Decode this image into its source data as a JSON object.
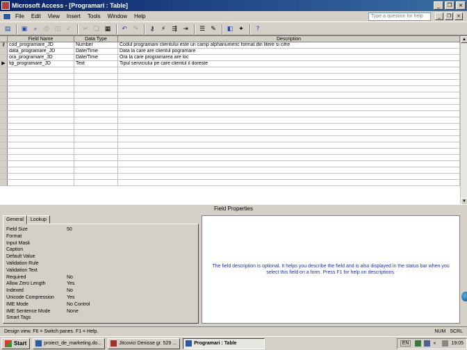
{
  "window": {
    "title": "Microsoft Access - [Programari : Table]"
  },
  "menu": {
    "items": [
      "File",
      "Edit",
      "View",
      "Insert",
      "Tools",
      "Window",
      "Help"
    ],
    "help_placeholder": "Type a question for help"
  },
  "toolbar": {
    "icons": [
      "view-icon",
      "save-icon",
      "search-icon",
      "print-icon",
      "preview-icon",
      "spelling-icon",
      "cut-icon",
      "copy-icon",
      "paste-icon",
      "undo-icon",
      "redo-icon",
      "primary-key-icon",
      "indexes-icon",
      "insert-rows-icon",
      "delete-rows-icon",
      "properties-icon",
      "build-icon",
      "database-window-icon",
      "new-object-icon",
      "help-icon"
    ]
  },
  "table": {
    "headers": {
      "field_name": "Field Name",
      "data_type": "Data Type",
      "description": "Description"
    },
    "rows": [
      {
        "field_name": "cod_programare_JD",
        "data_type": "Number",
        "description": "Codul programarii clientului este un camp alphanumeric format din litere si cifre",
        "primary_key": true
      },
      {
        "field_name": "data_programare_JD",
        "data_type": "Date/Time",
        "description": "Data la care are clientul pogramare"
      },
      {
        "field_name": "ora_programare_JD",
        "data_type": "Date/Time",
        "description": "Ora la care programarea are loc"
      },
      {
        "field_name": "tip_programare_JD",
        "data_type": "Text",
        "description": "Tipul serviciului pe care clientul il doreste",
        "current": true
      }
    ]
  },
  "field_properties": {
    "label": "Field Properties",
    "tabs": [
      "General",
      "Lookup"
    ],
    "properties": [
      {
        "name": "Field Size",
        "value": "50"
      },
      {
        "name": "Format",
        "value": ""
      },
      {
        "name": "Input Mask",
        "value": ""
      },
      {
        "name": "Caption",
        "value": ""
      },
      {
        "name": "Default Value",
        "value": ""
      },
      {
        "name": "Validation Rule",
        "value": ""
      },
      {
        "name": "Validation Text",
        "value": ""
      },
      {
        "name": "Required",
        "value": "No"
      },
      {
        "name": "Allow Zero Length",
        "value": "Yes"
      },
      {
        "name": "Indexed",
        "value": "No"
      },
      {
        "name": "Unicode Compression",
        "value": "Yes"
      },
      {
        "name": "IME Mode",
        "value": "No Control"
      },
      {
        "name": "IME Sentence Mode",
        "value": "None"
      },
      {
        "name": "Smart Tags",
        "value": ""
      }
    ],
    "help_text": "The field description is optional.  It helps you describe the field and is also displayed in the status bar when you select this field on a form.  Press F1 for help on descriptions."
  },
  "statusbar": {
    "text": "Design view.  F6 = Switch panes.  F1 = Help.",
    "num": "NUM",
    "scrl": "SCRL"
  },
  "taskbar": {
    "start": "Start",
    "buttons": [
      {
        "label": "proiect_de_marketing.do...",
        "icon_color": "#2a5aa0",
        "active": false
      },
      {
        "label": "Jitcovici Denisse gr. 529 ...",
        "icon_color": "#a0302a",
        "active": false
      },
      {
        "label": "Programari : Table",
        "icon_color": "#2a5aa0",
        "active": true
      }
    ],
    "lang": "EN",
    "time": "19:05"
  }
}
